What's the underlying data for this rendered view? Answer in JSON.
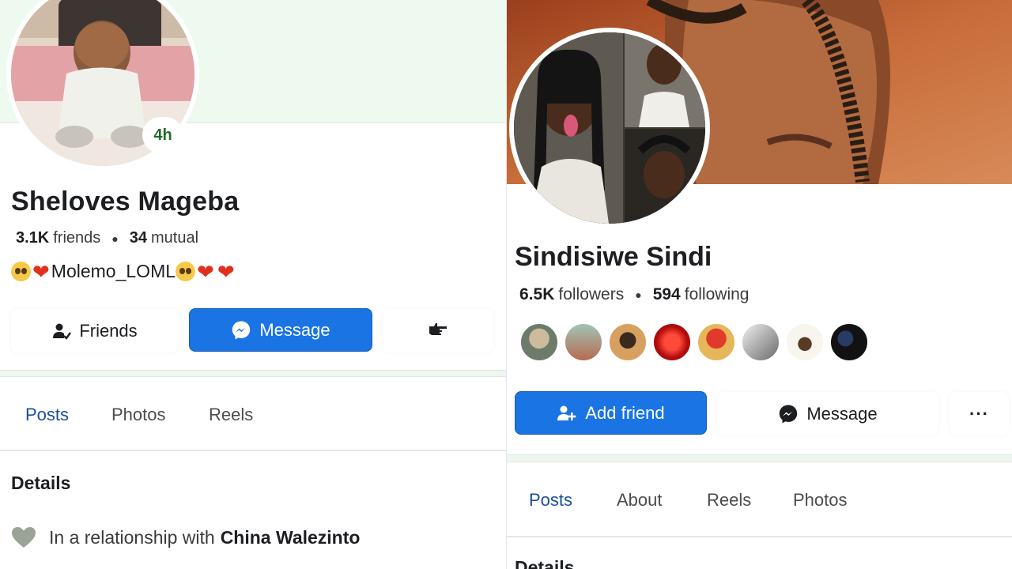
{
  "left_profile": {
    "story_badge": "4h",
    "name": "Sheloves Mageba",
    "friends_count": "3.1K",
    "friends_label": "friends",
    "mutual_count": "34",
    "mutual_label": "mutual",
    "bio_text": "Molemo_LOML",
    "buttons": {
      "friends": "Friends",
      "message": "Message"
    },
    "tabs": [
      "Posts",
      "Photos",
      "Reels"
    ],
    "active_tab": "Posts",
    "details_title": "Details",
    "relationship_prefix": "In a relationship with",
    "relationship_name": "China Walezinto",
    "icons": [
      "friends-check-icon",
      "messenger-icon",
      "pointing-hand-icon",
      "heart-icon",
      "pleading-face-emoji",
      "red-heart-emoji"
    ]
  },
  "right_profile": {
    "name": "Sindisiwe Sindi",
    "followers_count": "6.5K",
    "followers_label": "followers",
    "following_count": "594",
    "following_label": "following",
    "mutual_friend_avatars": 8,
    "buttons": {
      "add_friend": "Add friend",
      "message": "Message",
      "more": "···"
    },
    "tabs": [
      "Posts",
      "About",
      "Reels",
      "Photos"
    ],
    "active_tab": "Posts",
    "details_title": "Details",
    "icons": [
      "add-friend-icon",
      "messenger-icon",
      "more-icon"
    ]
  },
  "colors": {
    "brand_blue": "#1b74e4",
    "active_tab": "#1a4ea0",
    "left_cover": "#eefaf0",
    "badge_green": "#1f6b2a"
  }
}
